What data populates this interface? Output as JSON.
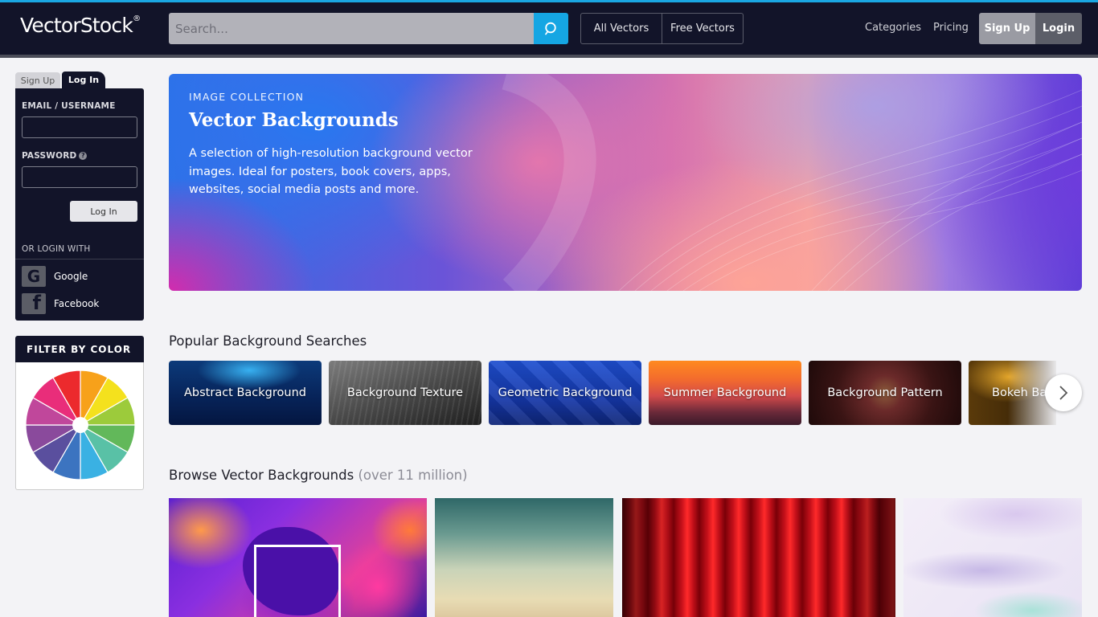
{
  "header": {
    "logo_text": "VectorStock",
    "logo_mark": "®",
    "search_placeholder": "Search...",
    "tabs": [
      "All Vectors",
      "Free Vectors"
    ],
    "nav": [
      "Categories",
      "Pricing"
    ],
    "signup_label": "Sign Up",
    "login_label": "Login",
    "accent_color": "#15a6e3"
  },
  "login_box": {
    "tab_signup": "Sign Up",
    "tab_login": "Log In",
    "email_label": "EMAIL / USERNAME",
    "password_label": "PASSWORD",
    "help_glyph": "?",
    "submit_label": "Log In",
    "or_login_with": "OR LOGIN WITH",
    "socials": [
      {
        "label": "Google",
        "icon": "google-icon",
        "glyph": "G"
      },
      {
        "label": "Facebook",
        "icon": "facebook-icon",
        "glyph": "f"
      }
    ]
  },
  "filter": {
    "title": "FILTER BY COLOR",
    "colors": [
      "#f7a11a",
      "#f4e11d",
      "#9ccb3b",
      "#62b85a",
      "#59c1a6",
      "#3ab1e3",
      "#3c74c0",
      "#5a4f9e",
      "#8a4a9c",
      "#c0479b",
      "#e92d7a",
      "#ec2a2d"
    ]
  },
  "hero": {
    "kicker": "IMAGE COLLECTION",
    "title": "Vector Backgrounds",
    "description": "A selection of high-resolution background vector images. Ideal for posters, book covers, apps, websites, social media posts and more."
  },
  "popular": {
    "title": "Popular Background Searches",
    "items": [
      "Abstract Background",
      "Background Texture",
      "Geometric Background",
      "Summer Background",
      "Background Pattern",
      "Bokeh Background"
    ]
  },
  "browse": {
    "title": "Browse Vector Backgrounds",
    "count": "(over 11 million)"
  }
}
